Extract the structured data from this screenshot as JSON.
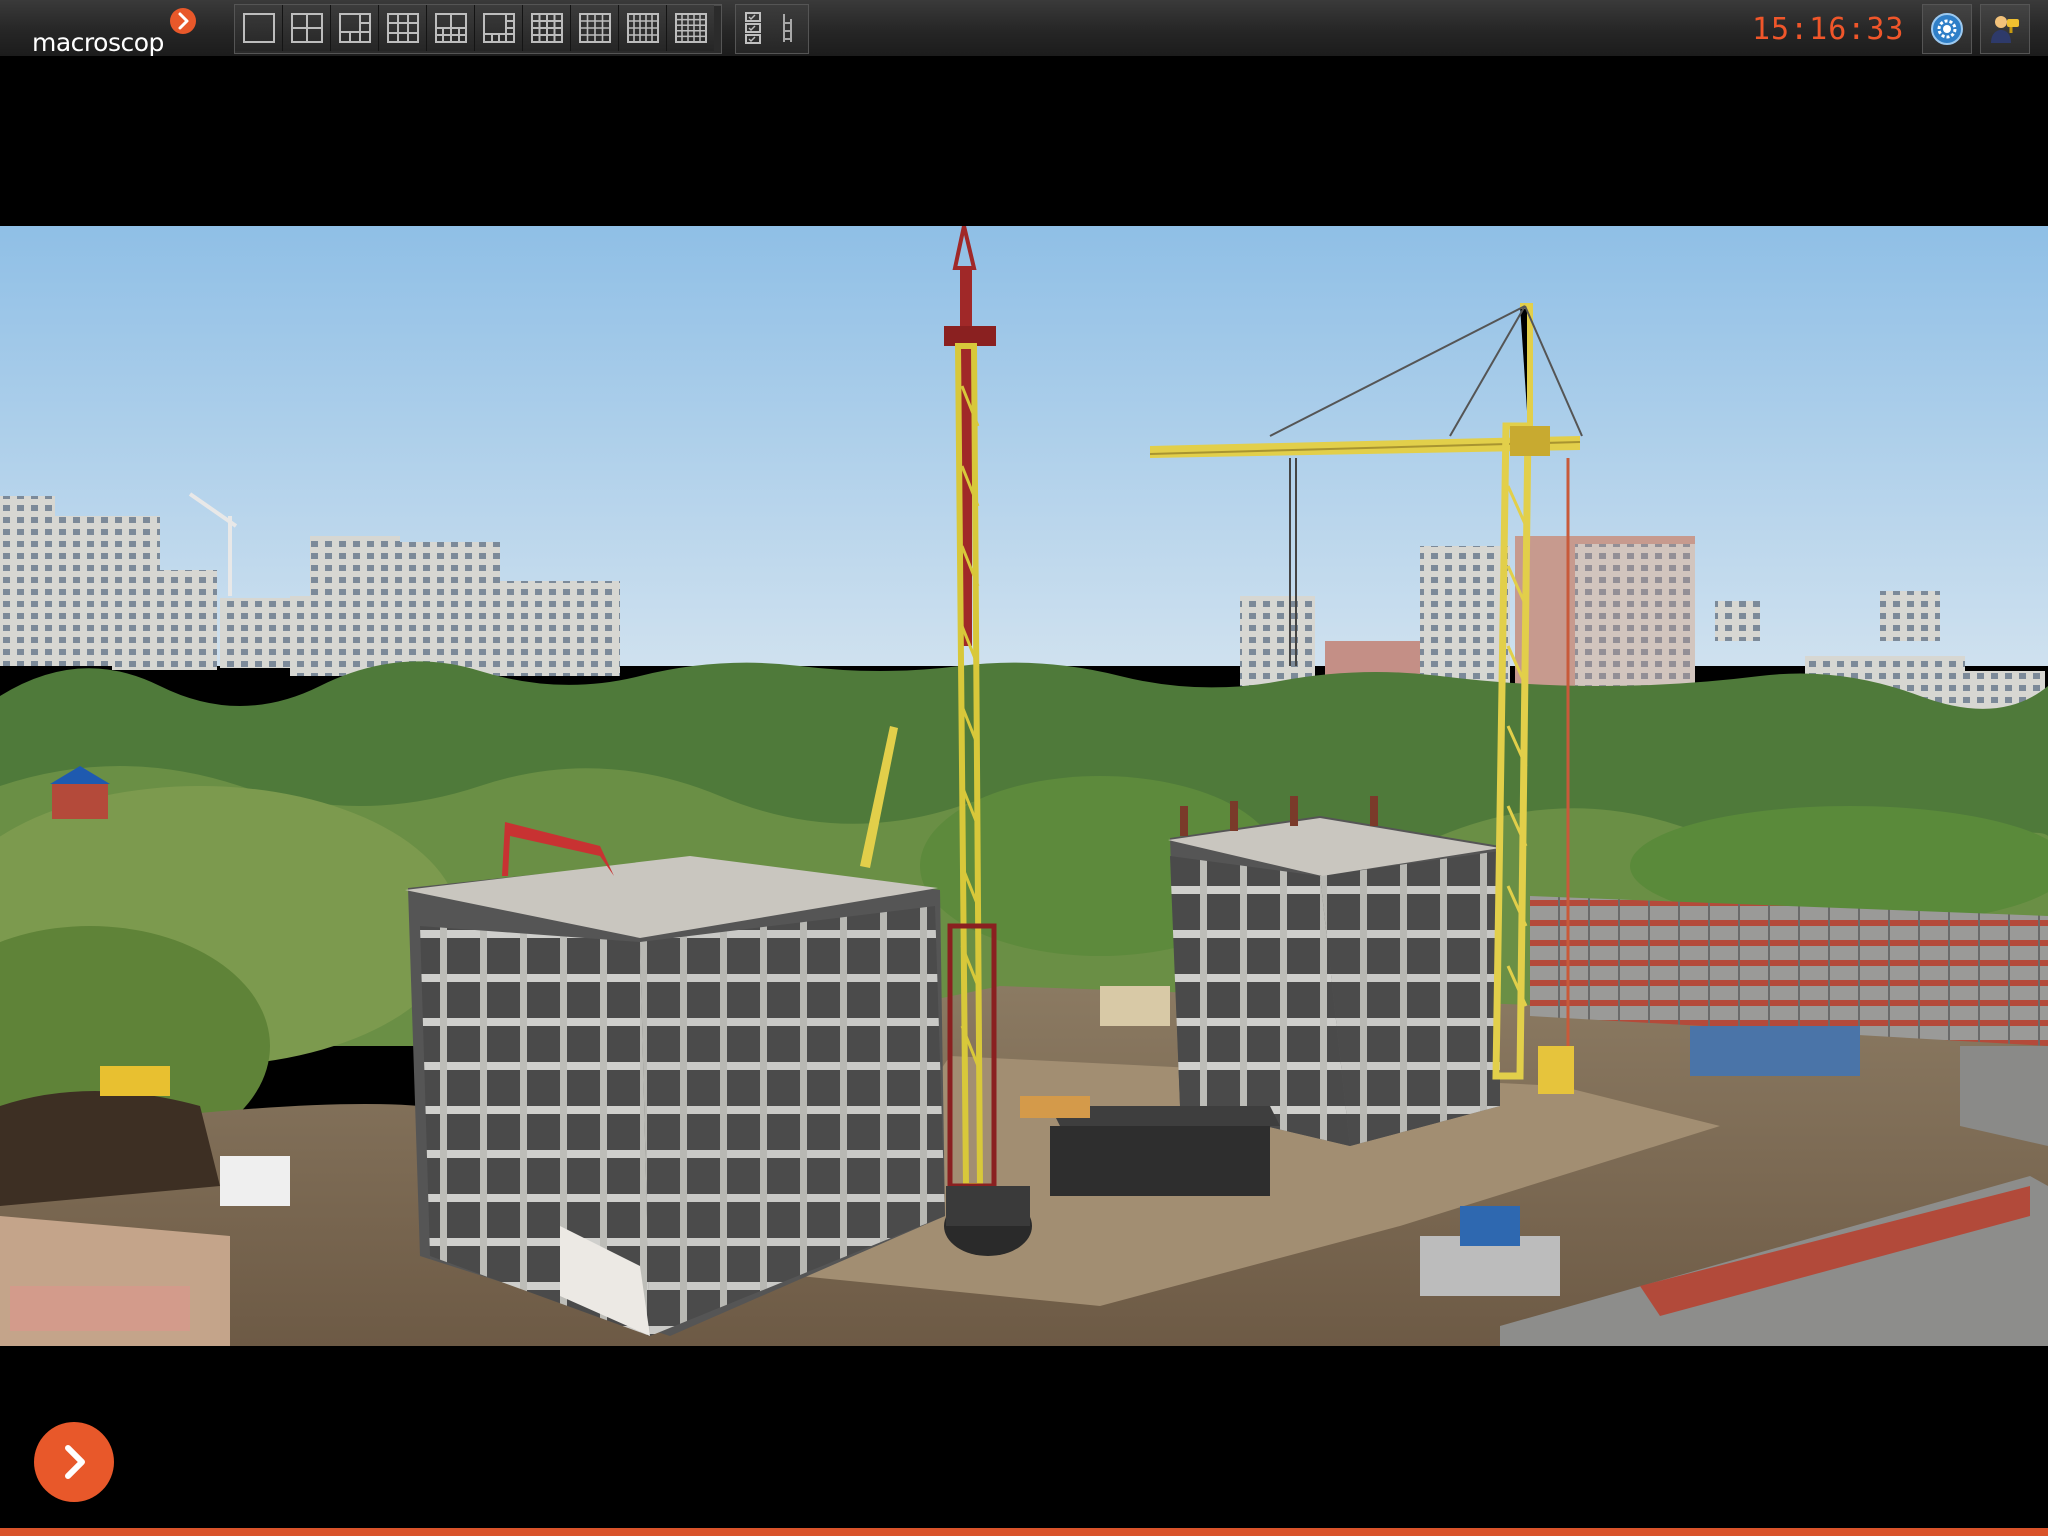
{
  "app": {
    "logo_text": "macroscop",
    "brand_color": "#e8582a",
    "clock": "15:16:33",
    "clock_color": "#f0562a"
  },
  "toolbar": {
    "layouts": [
      {
        "name": "layout-1x1-icon",
        "grid": [
          1,
          1
        ]
      },
      {
        "name": "layout-2x2-icon",
        "grid": [
          2,
          2
        ]
      },
      {
        "name": "layout-1plus5-icon",
        "grid": "1+5"
      },
      {
        "name": "layout-3x3-icon",
        "grid": [
          3,
          3
        ]
      },
      {
        "name": "layout-2plus8-icon",
        "grid": "2+8"
      },
      {
        "name": "layout-1plus7-icon",
        "grid": "1+7"
      },
      {
        "name": "layout-4x4-icon",
        "grid": [
          4,
          4
        ]
      },
      {
        "name": "layout-4x4b-icon",
        "grid": [
          4,
          4
        ]
      },
      {
        "name": "layout-5x4-icon",
        "grid": [
          5,
          4
        ]
      },
      {
        "name": "layout-5x5-icon",
        "grid": [
          5,
          5
        ]
      }
    ],
    "extra_buttons": [
      "camera-list-icon",
      "tree-view-icon"
    ],
    "right_buttons": [
      "settings-icon",
      "user-icon"
    ]
  },
  "video": {
    "scene": "construction-site-camera-feed"
  },
  "navigation": {
    "next_icon": "chevron-right-icon"
  }
}
